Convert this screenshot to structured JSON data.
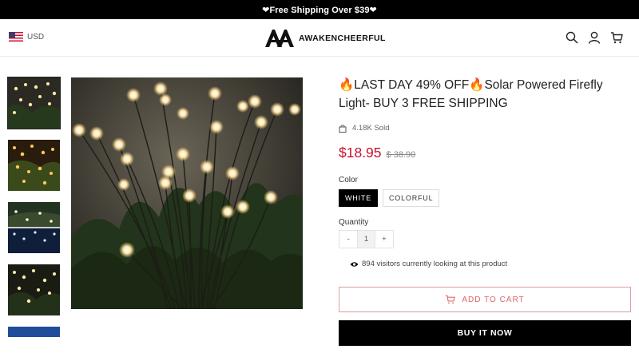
{
  "announcement": {
    "text": "❤Free Shipping Over $39❤"
  },
  "header": {
    "currency": "USD",
    "currency_flag_icon": "us-flag-icon",
    "brand": "AWAKENCHEERFUL",
    "icons": [
      "search-icon",
      "account-icon",
      "cart-icon"
    ]
  },
  "gallery": {
    "thumbnail_count": 5,
    "active_index": 0
  },
  "product": {
    "title": "🔥LAST DAY 49% OFF🔥Solar Powered Firefly Light- BUY 3 FREE SHIPPING",
    "sold": "4.18K Sold",
    "price": "$18.95",
    "compare_price": "$ 38.90",
    "color_label": "Color",
    "variants": [
      "WHITE",
      "COLORFUL"
    ],
    "selected_variant": "WHITE",
    "quantity_label": "Quantity",
    "quantity": {
      "minus": "-",
      "value": "1",
      "plus": "+"
    },
    "visitors": "894 visitors currently looking at this product",
    "add_to_cart": "ADD TO CART",
    "buy_now": "BUY IT NOW"
  },
  "colors": {
    "price": "#c8102e",
    "add_to_cart": "#dd6666",
    "primary": "#000000"
  }
}
